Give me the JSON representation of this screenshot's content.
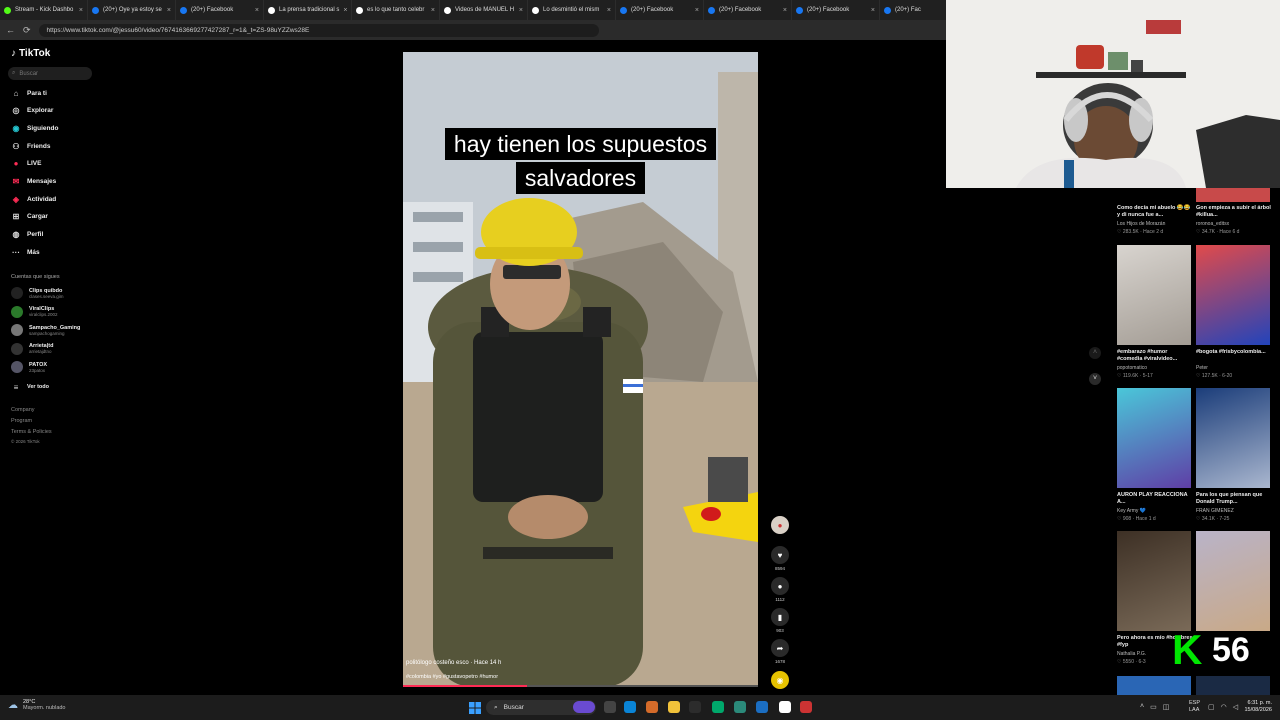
{
  "browser": {
    "tabs": [
      {
        "title": "Stream - Kick Dashbo",
        "color": "#53fc18"
      },
      {
        "title": "(20+) Oye ya estoy se",
        "color": "#1877f2"
      },
      {
        "title": "(20+) Facebook",
        "color": "#1877f2"
      },
      {
        "title": "La prensa tradicional s",
        "color": "#ffffff"
      },
      {
        "title": "es lo que tanto celebr",
        "color": "#ffffff"
      },
      {
        "title": "Videos de MANUEL H",
        "color": "#ffffff"
      },
      {
        "title": "Lo desmintió el mism",
        "color": "#ffffff"
      },
      {
        "title": "(20+) Facebook",
        "color": "#1877f2"
      },
      {
        "title": "(20+) Facebook",
        "color": "#1877f2"
      },
      {
        "title": "(20+) Facebook",
        "color": "#1877f2"
      },
      {
        "title": "(20+) Fac",
        "color": "#1877f2"
      }
    ],
    "url": "https://www.tiktok.com/@jessu60/video/7674163669277427287_r=1&_t=ZS-98uYZZws28E"
  },
  "sidebar": {
    "logo": "TikTok",
    "search_placeholder": "Buscar",
    "nav": [
      {
        "label": "Para ti",
        "icon": "home-icon"
      },
      {
        "label": "Explorar",
        "icon": "compass-icon"
      },
      {
        "label": "Siguiendo",
        "icon": "following-icon"
      },
      {
        "label": "Friends",
        "icon": "friends-icon"
      },
      {
        "label": "LIVE",
        "icon": "live-icon"
      },
      {
        "label": "Mensajes",
        "icon": "messages-icon"
      },
      {
        "label": "Actividad",
        "icon": "activity-icon"
      },
      {
        "label": "Cargar",
        "icon": "upload-icon"
      },
      {
        "label": "Perfil",
        "icon": "profile-icon"
      },
      {
        "label": "Más",
        "icon": "more-icon"
      }
    ],
    "following_header": "Cuentas que sigues",
    "following": [
      {
        "name": "Clips quibdo",
        "handle": "clases.seeva.gim"
      },
      {
        "name": "ViralClips",
        "handle": "viralclips.2002"
      },
      {
        "name": "Sampacho_Gaming",
        "handle": "sampachogaming"
      },
      {
        "name": "Arrieta|td",
        "handle": "arrietajdtno"
      },
      {
        "name": "PATOX",
        "handle": "23patox"
      }
    ],
    "see_all": "Ver todo",
    "footer": [
      "Company",
      "Program",
      "Terms & Policies",
      "© 2026 TikTok"
    ]
  },
  "video": {
    "caption_line1": "hay tienen los supuestos",
    "caption_line2": "salvadores",
    "author_line": "politólogo costeño esco · Hace 14 h",
    "hashtags": "#colombia #yo #gustavopetro #humor",
    "progress": 0.35
  },
  "actions": [
    {
      "name": "like",
      "icon": "heart-icon",
      "count": "8594"
    },
    {
      "name": "comment",
      "icon": "comment-icon",
      "count": "1112"
    },
    {
      "name": "save",
      "icon": "bookmark-icon",
      "count": "903"
    },
    {
      "name": "share",
      "icon": "share-icon",
      "count": "1678"
    }
  ],
  "recommendations": [
    {
      "title": "Como decía mi abuelo 😂😂 y di nunca fue a...",
      "author": "Los Hijos de Morazán",
      "stats": "♡ 283.5K · Hace 2 d"
    },
    {
      "title": "Gon empieza a subir el árbol #killua...",
      "author": "roronoa_editsx",
      "stats": "♡ 34.7K · Hace 6 d"
    },
    {
      "title": "#embarazo #humor #comedia #viralvideo...",
      "author": "popotomatico",
      "stats": "♡ 119.6K · 5-17"
    },
    {
      "title": "#bogota #frisbycolombia...",
      "author": "Peter",
      "stats": "♡ 127.5K · 6-20"
    },
    {
      "title": "AURON PLAY REACCIONA A...",
      "author": "Key Army 💙",
      "stats": "♡ 908 · Hace 1 d"
    },
    {
      "title": "Para los que piensan que Donald Trump...",
      "author": "FRAN GIMENEZ",
      "stats": "♡ 34.1K · 7-25"
    },
    {
      "title": "Pero ahora es mío #hombres #fyp",
      "author": "Nathalia P.G.",
      "stats": "♡ 5550 · 6-3"
    },
    {
      "title": "",
      "author": "",
      "stats": ""
    }
  ],
  "overlay": {
    "counter_letter": "K",
    "counter_value": "56"
  },
  "taskbar": {
    "weather_temp": "28°C",
    "weather_desc": "Mayorm. nublado",
    "search": "Buscar",
    "lang1": "ESP",
    "lang2": "LAA",
    "time": "6:31 p. m.",
    "date": "15/08/2026"
  }
}
